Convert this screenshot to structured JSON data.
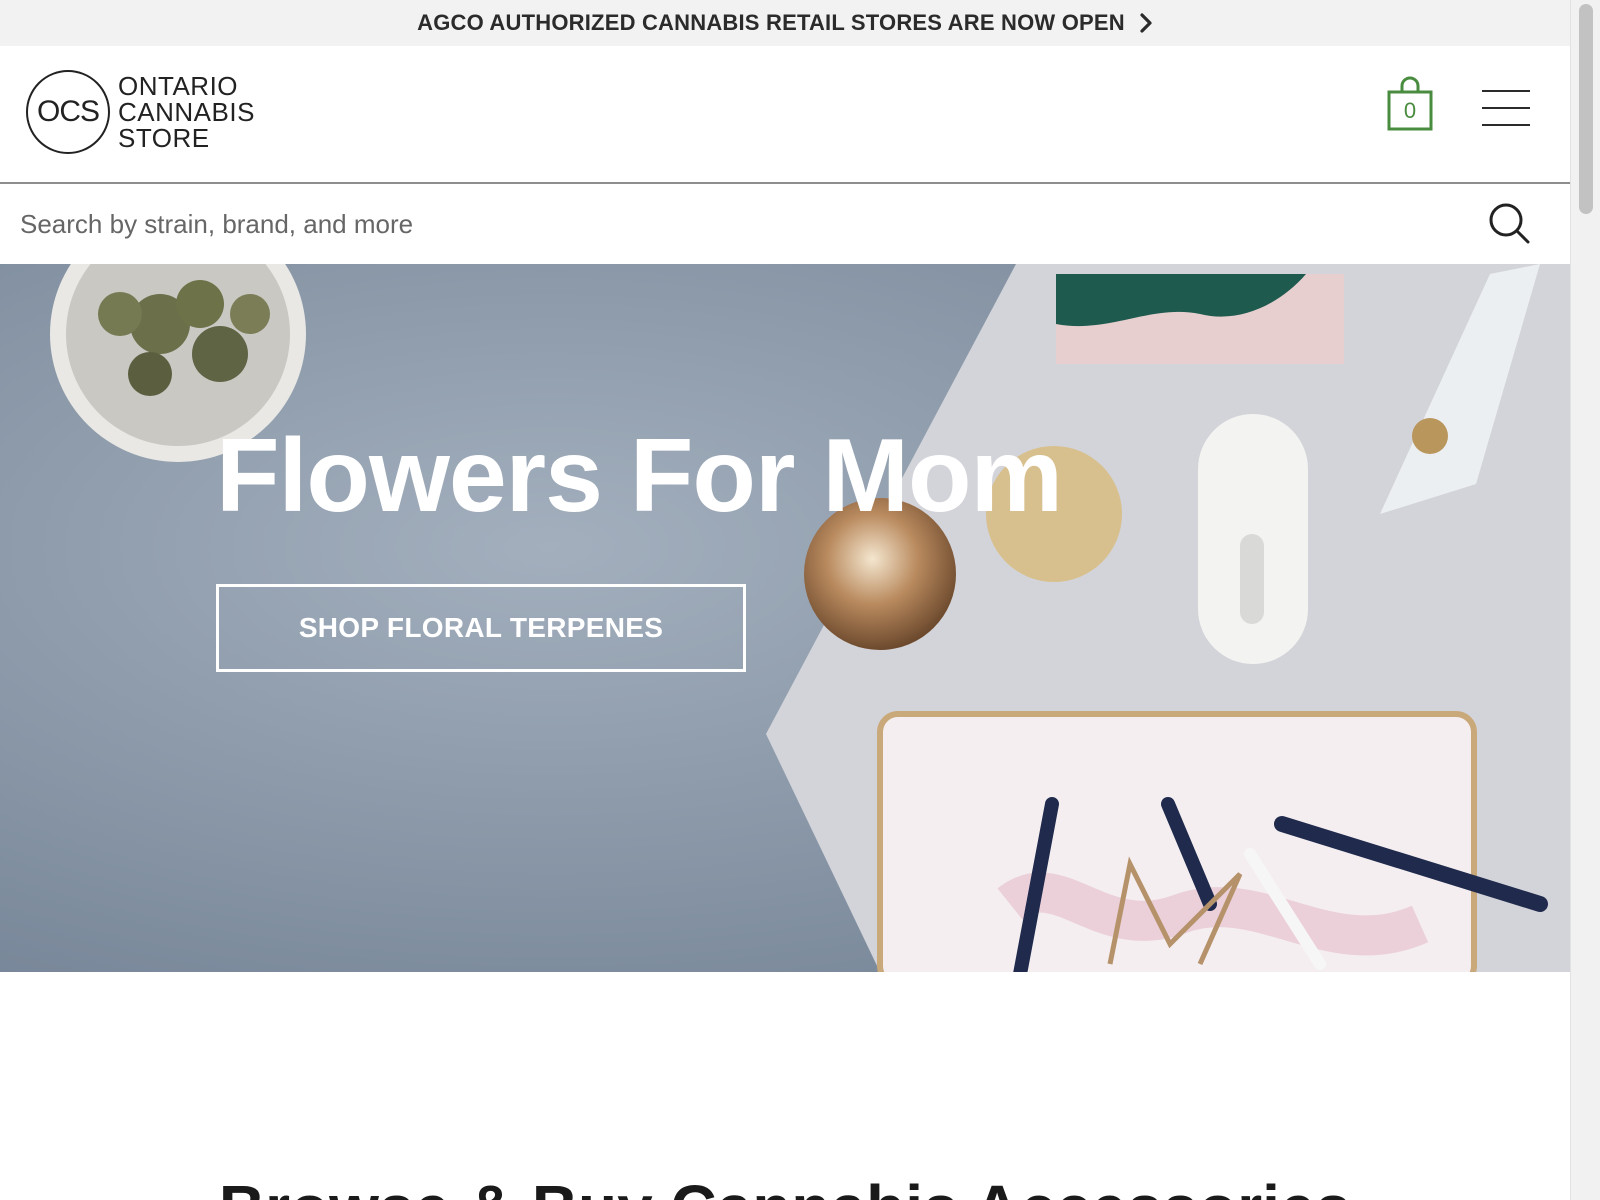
{
  "announcement": {
    "text": "AGCO AUTHORIZED CANNABIS RETAIL STORES ARE NOW OPEN",
    "icon": "chevron-right-icon"
  },
  "header": {
    "logo": {
      "mark": "OCS",
      "lines": [
        "ONTARIO",
        "CANNABIS",
        "STORE"
      ]
    },
    "cart": {
      "count": "0",
      "icon": "shopping-bag-icon",
      "color": "#4a8c3f"
    },
    "menu_icon": "hamburger-menu-icon"
  },
  "search": {
    "placeholder": "Search by strain, brand, and more",
    "value": "",
    "icon": "search-icon"
  },
  "hero": {
    "title": "Flowers For Mom",
    "cta_label": "SHOP FLORAL TERPENES"
  },
  "section": {
    "title": "Browse & Buy Cannabis Accessories"
  }
}
